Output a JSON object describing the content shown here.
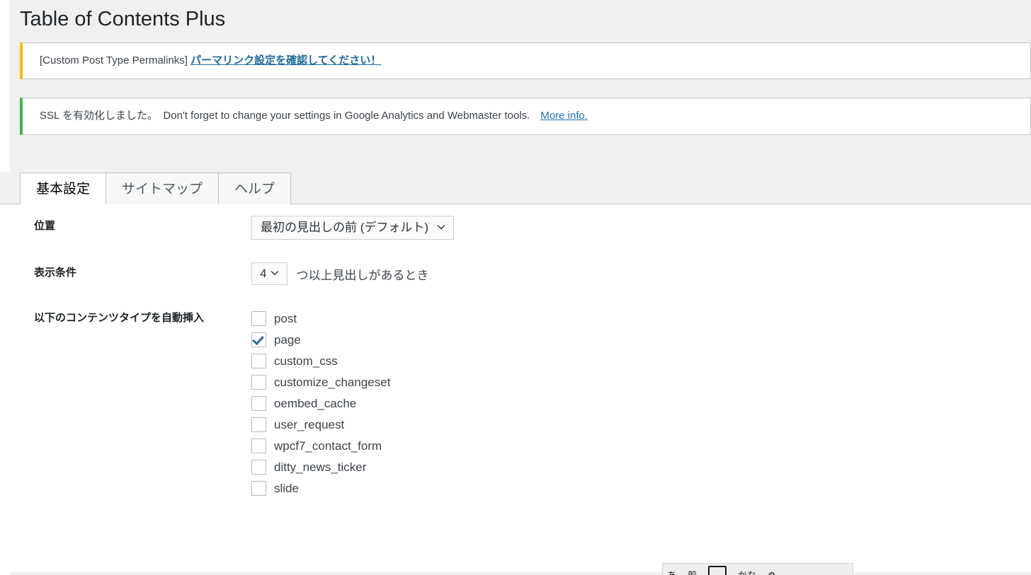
{
  "page": {
    "title": "Table of Contents Plus"
  },
  "notices": [
    {
      "type": "warning",
      "prefix": "[Custom Post Type Permalinks] ",
      "link_text": "パーマリンク設定を確認してください！"
    },
    {
      "type": "success",
      "text": "SSL を有効化しました。　Don't forget to change your settings in Google Analytics and Webmaster tools.　",
      "link_text": "More info."
    }
  ],
  "tabs": [
    {
      "label": "基本設定",
      "active": true
    },
    {
      "label": "サイトマップ",
      "active": false
    },
    {
      "label": "ヘルプ",
      "active": false
    }
  ],
  "form": {
    "position": {
      "label": "位置",
      "value": "最初の見出しの前 (デフォルト)"
    },
    "condition": {
      "label": "表示条件",
      "value": "4",
      "suffix": "つ以上見出しがあるとき"
    },
    "auto_insert": {
      "label": "以下のコンテンツタイプを自動挿入",
      "items": [
        {
          "name": "post",
          "checked": false
        },
        {
          "name": "page",
          "checked": true
        },
        {
          "name": "custom_css",
          "checked": false
        },
        {
          "name": "customize_changeset",
          "checked": false
        },
        {
          "name": "oembed_cache",
          "checked": false
        },
        {
          "name": "user_request",
          "checked": false
        },
        {
          "name": "wpcf7_contact_form",
          "checked": false
        },
        {
          "name": "ditty_news_ticker",
          "checked": false
        },
        {
          "name": "slide",
          "checked": false
        }
      ]
    }
  },
  "ime_bar": {
    "items": [
      "あ",
      "般",
      "",
      "かな",
      "⚙"
    ]
  },
  "colors": {
    "warning_border": "#ffb900",
    "success_border": "#46b450",
    "link": "#2271b1",
    "checkbox_check": "#2e6e8e",
    "page_background": "#f0f0f1"
  }
}
